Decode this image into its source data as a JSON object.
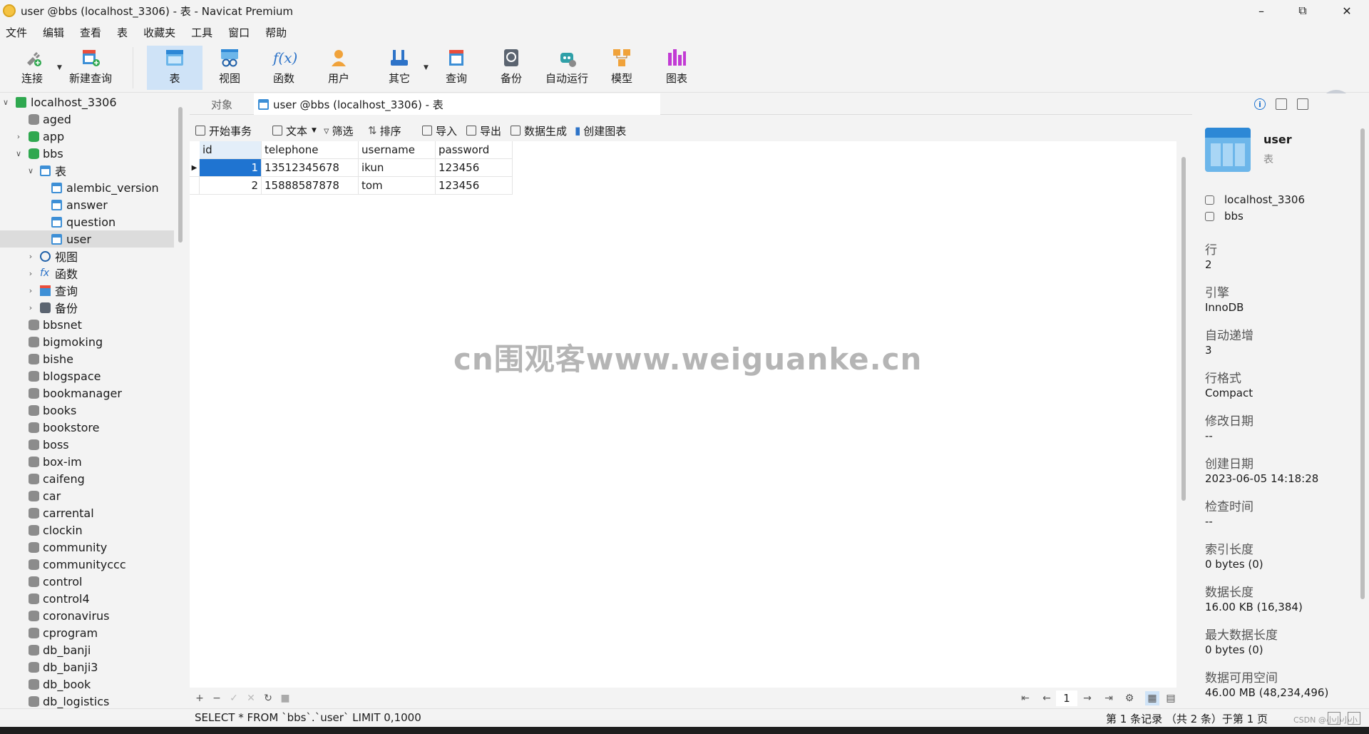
{
  "window": {
    "title": "user @bbs (localhost_3306) - 表 - Navicat Premium"
  },
  "menu": [
    "文件",
    "编辑",
    "查看",
    "表",
    "收藏夹",
    "工具",
    "窗口",
    "帮助"
  ],
  "toolbar": {
    "connect": "连接",
    "new_query": "新建查询",
    "table": "表",
    "view": "视图",
    "function": "函数",
    "user": "用户",
    "other": "其它",
    "query": "查询",
    "backup": "备份",
    "auto_run": "自动运行",
    "model": "模型",
    "chart": "图表",
    "function_symbol": "f(x)"
  },
  "tree": {
    "connection": "localhost_3306",
    "databases_top": [
      "aged",
      "app",
      "bbs"
    ],
    "table_group": "表",
    "tables": [
      "alembic_version",
      "answer",
      "question",
      "user"
    ],
    "groups": [
      "视图",
      "函数",
      "查询",
      "备份"
    ],
    "databases_rest": [
      "bbsnet",
      "bigmoking",
      "bishe",
      "blogspace",
      "bookmanager",
      "books",
      "bookstore",
      "boss",
      "box-im",
      "caifeng",
      "car",
      "carrental",
      "clockin",
      "community",
      "communityccc",
      "control",
      "control4",
      "coronavirus",
      "cprogram",
      "db_banji",
      "db_banji3",
      "db_book",
      "db_logistics"
    ]
  },
  "tabs": {
    "objects": "对象",
    "active": "user @bbs (localhost_3306) - 表"
  },
  "subtoolbar": {
    "begin_tx": "开始事务",
    "text": "文本",
    "filter": "筛选",
    "sort": "排序",
    "import": "导入",
    "export": "导出",
    "data_gen": "数据生成",
    "create_chart": "创建图表"
  },
  "grid": {
    "columns": [
      "id",
      "telephone",
      "username",
      "password"
    ],
    "rows": [
      [
        "1",
        "13512345678",
        "ikun",
        "123456"
      ],
      [
        "2",
        "15888587878",
        "tom",
        "123456"
      ]
    ]
  },
  "watermark": "cn围观客www.weiguanke.cn",
  "gridbar": {
    "page": "1"
  },
  "status": {
    "sql": "SELECT * FROM `bbs`.`user` LIMIT 0,1000",
    "records": "第 1 条记录 （共 2 条）于第 1 页",
    "credit": "CSDN @小小小小"
  },
  "info": {
    "name": "user",
    "type": "表",
    "connection": "localhost_3306",
    "database": "bbs",
    "fields": [
      {
        "label": "行",
        "value": "2"
      },
      {
        "label": "引擎",
        "value": "InnoDB"
      },
      {
        "label": "自动递增",
        "value": "3"
      },
      {
        "label": "行格式",
        "value": "Compact"
      },
      {
        "label": "修改日期",
        "value": "--"
      },
      {
        "label": "创建日期",
        "value": "2023-06-05 14:18:28"
      },
      {
        "label": "检查时间",
        "value": "--"
      },
      {
        "label": "索引长度",
        "value": "0 bytes (0)"
      },
      {
        "label": "数据长度",
        "value": "16.00 KB (16,384)"
      },
      {
        "label": "最大数据长度",
        "value": "0 bytes (0)"
      },
      {
        "label": "数据可用空间",
        "value": "46.00 MB (48,234,496)"
      }
    ]
  }
}
